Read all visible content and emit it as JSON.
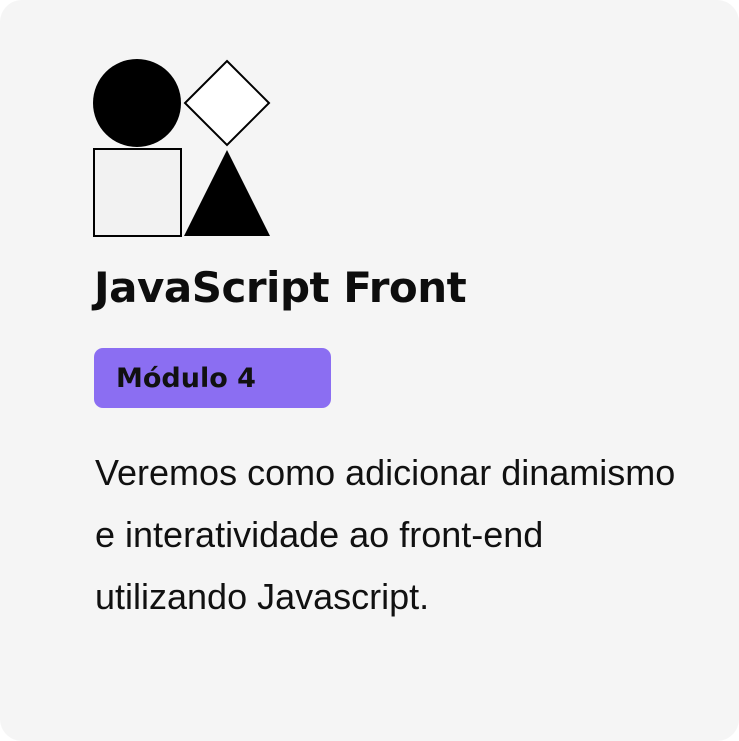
{
  "card": {
    "title": "JavaScript Front",
    "badge_label": "Módulo 4",
    "description": "Veremos como adicionar dinamismo e interatividade ao front-end utilizando Javascript.",
    "icon": "geometric-shapes-icon",
    "colors": {
      "background": "#f5f5f5",
      "badge": "#8b6ef2",
      "text": "#111111"
    }
  }
}
